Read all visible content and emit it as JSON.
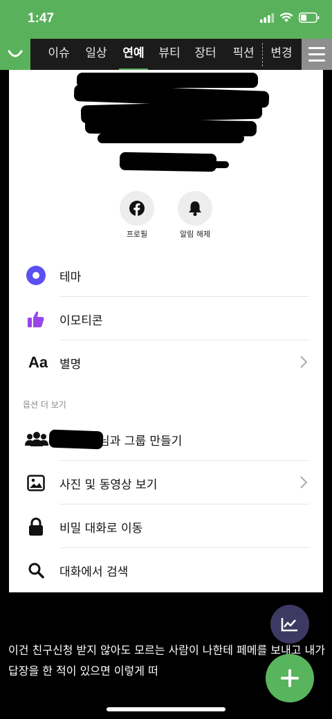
{
  "status_bar": {
    "time": "1:47",
    "icons": [
      "signal-icon",
      "wifi-icon",
      "battery-icon"
    ]
  },
  "tabbar": {
    "logo_icon": "app-logo-icon",
    "tabs": [
      {
        "label": "이슈",
        "active": false
      },
      {
        "label": "일상",
        "active": false
      },
      {
        "label": "연예",
        "active": true
      },
      {
        "label": "뷰티",
        "active": false
      },
      {
        "label": "장터",
        "active": false
      },
      {
        "label": "픽션",
        "active": false
      },
      {
        "label": "변경",
        "active": false
      }
    ],
    "menu_icon": "hamburger-menu-icon"
  },
  "profile": {
    "actions": [
      {
        "label": "프로필",
        "icon": "facebook-icon"
      },
      {
        "label": "알림 해제",
        "icon": "bell-icon"
      }
    ]
  },
  "settings": {
    "rows": [
      {
        "label": "테마",
        "icon": "theme-dot-icon",
        "chevron": false
      },
      {
        "label": "이모티콘",
        "icon": "thumbs-up-icon",
        "chevron": false
      },
      {
        "label": "별명",
        "icon": "text-aa-icon",
        "chevron": true
      }
    ]
  },
  "more_options": {
    "section_title": "옵션 더 보기",
    "rows": [
      {
        "label": "님과 그룹 만들기",
        "icon": "people-group-icon",
        "chevron": false
      },
      {
        "label": "사진 및 동영상 보기",
        "icon": "photo-icon",
        "chevron": true
      },
      {
        "label": "비밀 대화로 이동",
        "icon": "lock-icon",
        "chevron": false
      },
      {
        "label": "대화에서 검색",
        "icon": "search-icon",
        "chevron": false
      }
    ]
  },
  "caption": "이건 친구신청 받지 않아도 모르는 사람이 나한테 페메를 보내고 내가 답장을 한 적이 있으면 이렇게 떠",
  "fabs": {
    "small_icon": "trend-chart-icon",
    "big_icon": "plus-icon"
  },
  "colors": {
    "status_green": "#5ab15c",
    "tabbar_bg": "#1b1b1b",
    "theme_purple": "#5a4ff0",
    "emoji_purple": "#9747e8",
    "fab_dark": "#3c3a62",
    "fab_green": "#59b55d"
  }
}
